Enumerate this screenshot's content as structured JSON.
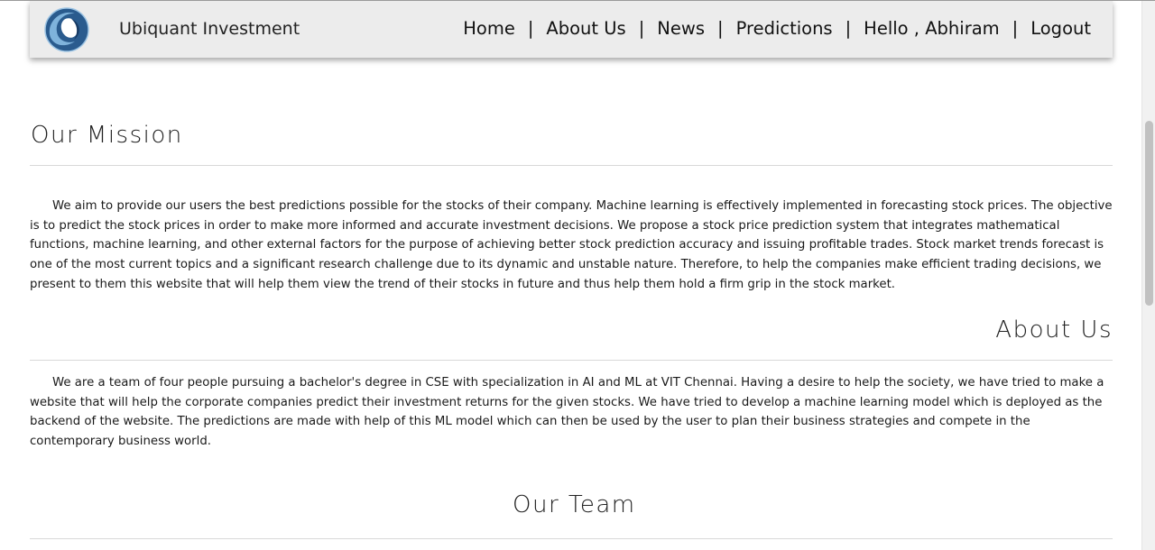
{
  "navbar": {
    "brand": "Ubiquant Investment",
    "items": [
      {
        "label": "Home"
      },
      {
        "label": "About Us"
      },
      {
        "label": "News"
      },
      {
        "label": "Predictions"
      },
      {
        "label": "Hello , Abhiram"
      },
      {
        "label": "Logout"
      }
    ],
    "separator": "|"
  },
  "mission": {
    "title": "Our Mission",
    "text": "We aim to provide our users the best predictions possible for the stocks of their company. Machine learning is effectively implemented in forecasting stock prices. The objective is to predict the stock prices in order to make more informed and accurate investment decisions. We propose a stock price prediction system that integrates mathematical functions, machine learning, and other external factors for the purpose of achieving better stock prediction accuracy and issuing profitable trades. Stock market trends forecast is one of the most current topics and a significant research challenge due to its dynamic and unstable nature. Therefore, to help the companies make efficient trading decisions, we present to them this website that will help them view the trend of their stocks in future and thus help them hold a firm grip in the stock market."
  },
  "about": {
    "title": "About Us",
    "text": "We are a team of four people pursuing a bachelor's degree in CSE with specialization in AI and ML at VIT Chennai. Having a desire to help the society, we have tried to make a website that will help the corporate companies predict their investment returns for the given stocks. We have tried to develop a machine learning model which is deployed as the backend of the website. The predictions are made with help of this ML model which can then be used by the user to plan their business strategies and compete in the contemporary business world."
  },
  "team": {
    "title": "Our Team"
  },
  "colors": {
    "navbar_bg": "#ececec",
    "logo_dark": "#1d3f6b",
    "logo_light": "#5b9fcf"
  },
  "icons": {
    "logo": "ubiquant-swirl-logo"
  }
}
